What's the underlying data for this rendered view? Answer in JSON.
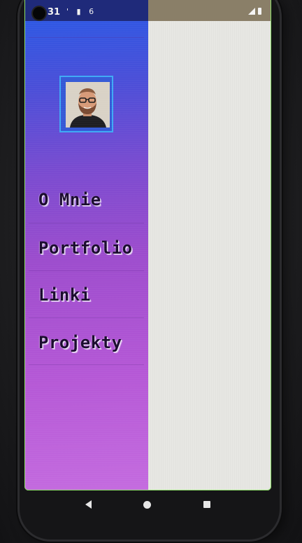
{
  "status_bar": {
    "time": "31",
    "left_icons": "' ▮ 6",
    "left_color": "#1f2a7a",
    "right_color": "#8a7f68"
  },
  "drawer": {
    "gradient_top": "#2f58e3",
    "gradient_bottom": "#c46bdf",
    "avatar_border_color": "#3fa9f5",
    "items": [
      {
        "label": "O Mnie"
      },
      {
        "label": "Portfolio"
      },
      {
        "label": "Linki"
      },
      {
        "label": "Projekty"
      }
    ]
  },
  "navigation_bar": {
    "buttons": [
      "back-icon",
      "home-icon",
      "recents-icon"
    ]
  }
}
